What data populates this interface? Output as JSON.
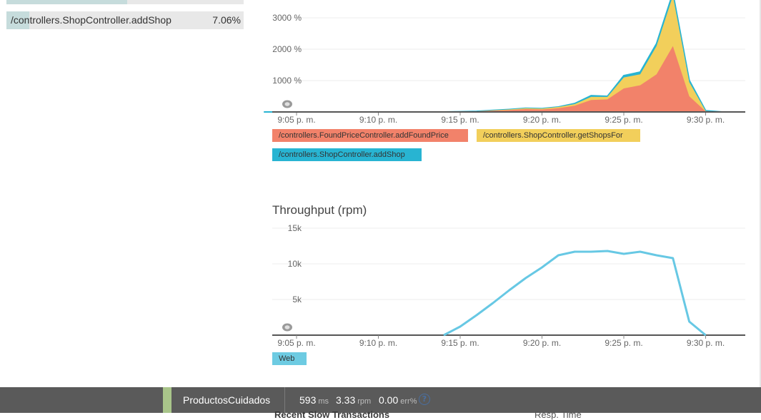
{
  "transactions": [
    {
      "name": "",
      "percent": ""
    },
    {
      "name": "/controllers.ShopController.addShop",
      "percent": "7.06%"
    }
  ],
  "time_ticks": [
    "9:05 p. m.",
    "9:10 p. m.",
    "9:15 p. m.",
    "9:20 p. m.",
    "9:25 p. m.",
    "9:30 p. m."
  ],
  "colors": {
    "red": "#f2826a",
    "yellow": "#f2cf5b",
    "cyan": "#28b4d2",
    "throughput_line": "#67c8e4",
    "web_legend": "#6dcbe2",
    "bottom_bar": "#5a5a5a",
    "app_accent": "#a9c58a"
  },
  "legend_top": {
    "found_price": "/controllers.FoundPriceController.addFoundPrice",
    "get_shops": "/controllers.ShopController.getShopsFor",
    "add_shop": "/controllers.ShopController.addShop"
  },
  "throughput": {
    "title": "Throughput (rpm)",
    "legend_web": "Web"
  },
  "chart_data": [
    {
      "type": "area",
      "stacked": true,
      "title": "",
      "x": [
        "9:03",
        "9:04",
        "9:05",
        "9:06",
        "9:07",
        "9:08",
        "9:09",
        "9:10",
        "9:11",
        "9:12",
        "9:13",
        "9:14",
        "9:15",
        "9:16",
        "9:17",
        "9:18",
        "9:19",
        "9:20",
        "9:21",
        "9:22",
        "9:23",
        "9:24",
        "9:25",
        "9:26",
        "9:27",
        "9:28",
        "9:29",
        "9:30",
        "9:31"
      ],
      "yticks": [
        "1000 %",
        "2000 %",
        "3000 %"
      ],
      "y_axis_values": [
        1000,
        2000,
        3000
      ],
      "ylim": [
        0,
        3300
      ],
      "series": [
        {
          "name": "/controllers.FoundPriceController.addFoundPrice",
          "values": [
            0,
            0,
            0,
            0,
            0,
            0,
            0,
            0,
            0,
            0,
            0,
            0,
            10,
            20,
            40,
            60,
            90,
            80,
            120,
            200,
            380,
            400,
            750,
            850,
            1200,
            2100,
            500,
            20,
            0
          ]
        },
        {
          "name": "/controllers.ShopController.getShopsFor",
          "values": [
            0,
            0,
            0,
            0,
            0,
            0,
            0,
            0,
            0,
            0,
            0,
            0,
            0,
            0,
            10,
            20,
            30,
            30,
            40,
            50,
            100,
            80,
            350,
            350,
            900,
            1600,
            450,
            10,
            0
          ]
        },
        {
          "name": "/controllers.ShopController.addShop",
          "values": [
            0,
            0,
            0,
            0,
            0,
            0,
            0,
            0,
            0,
            0,
            0,
            0,
            0,
            0,
            0,
            0,
            0,
            0,
            0,
            20,
            40,
            20,
            60,
            70,
            80,
            100,
            60,
            10,
            0
          ]
        }
      ]
    },
    {
      "type": "line",
      "title": "Throughput (rpm)",
      "x": [
        "9:14",
        "9:15",
        "9:16",
        "9:17",
        "9:18",
        "9:19",
        "9:20",
        "9:21",
        "9:22",
        "9:23",
        "9:24",
        "9:25",
        "9:26",
        "9:27",
        "9:28",
        "9:29",
        "9:30"
      ],
      "yticks": [
        "5k",
        "10k",
        "15k"
      ],
      "y_axis_values": [
        5000,
        10000,
        15000
      ],
      "ylim": [
        0,
        15000
      ],
      "series": [
        {
          "name": "Web",
          "values": [
            0,
            1200,
            2800,
            4500,
            6300,
            8000,
            9500,
            11200,
            11700,
            11700,
            11800,
            11400,
            11700,
            11200,
            10800,
            1900,
            0
          ]
        }
      ]
    }
  ],
  "status_bar": {
    "app_name": "ProductosCuidados",
    "response_time": "593",
    "response_unit": "ms",
    "throughput": "3.33",
    "throughput_unit": "rpm",
    "error_rate": "0.00",
    "error_unit": "err%",
    "help_glyph": "?",
    "help_icon": "question-circle-icon"
  },
  "below_fold": {
    "heading": "Recent Slow Transactions",
    "col": "Resp. Time"
  }
}
